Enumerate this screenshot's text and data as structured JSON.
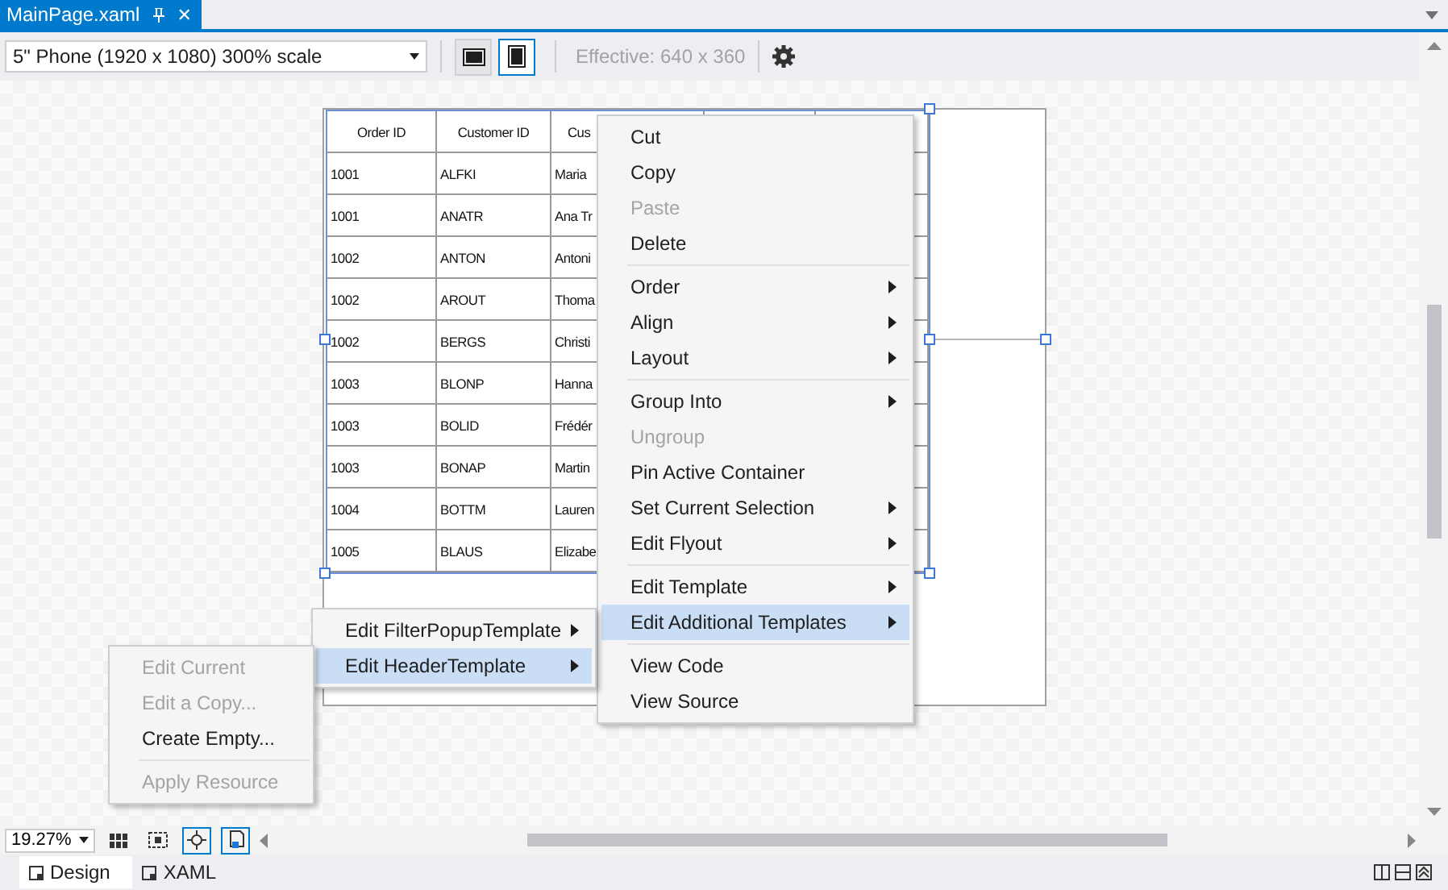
{
  "document_tab": {
    "title": "MainPage.xaml",
    "close": "✕"
  },
  "toolbar": {
    "device": "5\" Phone (1920 x 1080) 300% scale",
    "orientations": [
      {
        "kind": "landscape",
        "selected": false
      },
      {
        "kind": "portrait",
        "selected": true
      }
    ],
    "effective_size": "Effective: 640 x 360"
  },
  "grid": {
    "columns": [
      "Order ID",
      "Customer ID",
      "Cus"
    ],
    "rows": [
      [
        "1001",
        "ALFKI",
        "Maria"
      ],
      [
        "1001",
        "ANATR",
        "Ana Tr"
      ],
      [
        "1002",
        "ANTON",
        "Antoni"
      ],
      [
        "1002",
        "AROUT",
        "Thoma"
      ],
      [
        "1002",
        "BERGS",
        "Christi"
      ],
      [
        "1003",
        "BLONP",
        "Hanna"
      ],
      [
        "1003",
        "BOLID",
        "Frédér"
      ],
      [
        "1003",
        "BONAP",
        "Martin"
      ],
      [
        "1004",
        "BOTTM",
        "Lauren"
      ],
      [
        "1005",
        "BLAUS",
        "Elizabe"
      ]
    ]
  },
  "context_menu": [
    {
      "kind": "item",
      "label": "Cut",
      "disabled": false,
      "submenu": false,
      "selected": false
    },
    {
      "kind": "item",
      "label": "Copy",
      "disabled": false,
      "submenu": false,
      "selected": false
    },
    {
      "kind": "item",
      "label": "Paste",
      "disabled": true,
      "submenu": false,
      "selected": false
    },
    {
      "kind": "item",
      "label": "Delete",
      "disabled": false,
      "submenu": false,
      "selected": false
    },
    {
      "kind": "separator"
    },
    {
      "kind": "item",
      "label": "Order",
      "disabled": false,
      "submenu": true,
      "selected": false
    },
    {
      "kind": "item",
      "label": "Align",
      "disabled": false,
      "submenu": true,
      "selected": false
    },
    {
      "kind": "item",
      "label": "Layout",
      "disabled": false,
      "submenu": true,
      "selected": false
    },
    {
      "kind": "separator"
    },
    {
      "kind": "item",
      "label": "Group Into",
      "disabled": false,
      "submenu": true,
      "selected": false
    },
    {
      "kind": "item",
      "label": "Ungroup",
      "disabled": true,
      "submenu": false,
      "selected": false
    },
    {
      "kind": "item",
      "label": "Pin Active Container",
      "disabled": false,
      "submenu": false,
      "selected": false
    },
    {
      "kind": "item",
      "label": "Set Current Selection",
      "disabled": false,
      "submenu": true,
      "selected": false
    },
    {
      "kind": "item",
      "label": "Edit Flyout",
      "disabled": false,
      "submenu": true,
      "selected": false
    },
    {
      "kind": "separator"
    },
    {
      "kind": "item",
      "label": "Edit Template",
      "disabled": false,
      "submenu": true,
      "selected": false
    },
    {
      "kind": "item",
      "label": "Edit Additional Templates",
      "disabled": false,
      "submenu": true,
      "selected": true
    },
    {
      "kind": "separator"
    },
    {
      "kind": "item",
      "label": "View Code",
      "disabled": false,
      "submenu": false,
      "selected": false
    },
    {
      "kind": "item",
      "label": "View Source",
      "disabled": false,
      "submenu": false,
      "selected": false
    }
  ],
  "templates_submenu": [
    {
      "kind": "item",
      "label": "Edit FilterPopupTemplate",
      "disabled": false,
      "submenu": true,
      "selected": false
    },
    {
      "kind": "item",
      "label": "Edit HeaderTemplate",
      "disabled": false,
      "submenu": true,
      "selected": true
    }
  ],
  "header_template_submenu": [
    {
      "kind": "item",
      "label": "Edit Current",
      "disabled": true,
      "submenu": false,
      "selected": false
    },
    {
      "kind": "item",
      "label": "Edit a Copy...",
      "disabled": true,
      "submenu": false,
      "selected": false
    },
    {
      "kind": "item",
      "label": "Create Empty...",
      "disabled": false,
      "submenu": false,
      "selected": false
    },
    {
      "kind": "separator"
    },
    {
      "kind": "item",
      "label": "Apply Resource",
      "disabled": true,
      "submenu": false,
      "selected": false
    }
  ],
  "zoom": "19.27%",
  "view_tabs": [
    {
      "label": "Design",
      "selected": true
    },
    {
      "label": "XAML",
      "selected": false
    }
  ]
}
